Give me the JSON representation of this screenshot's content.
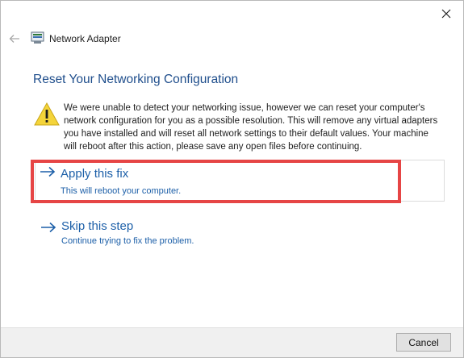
{
  "window": {
    "title": "Network Adapter",
    "close_icon": "close-icon",
    "back_icon": "back-arrow-icon",
    "app_icon": "network-adapter-icon"
  },
  "main": {
    "heading": "Reset Your Networking Configuration",
    "warning_icon": "warning-icon",
    "warning_text": "We were unable to detect your networking issue, however we can reset your computer's network configuration for you as a possible resolution. This will remove any virtual adapters you have installed and will reset all network settings to their default values. Your machine will reboot after this action, please save any open files before continuing.",
    "options": [
      {
        "title": "Apply this fix",
        "subtitle": "This will reboot your computer.",
        "icon": "arrow-right-icon"
      },
      {
        "title": "Skip this step",
        "subtitle": "Continue trying to fix the problem.",
        "icon": "arrow-right-icon"
      }
    ]
  },
  "footer": {
    "cancel_label": "Cancel"
  },
  "colors": {
    "heading": "#1f4e8c",
    "link": "#1c5fa8",
    "highlight": "#e64545",
    "footer_bg": "#f0f0f0"
  }
}
